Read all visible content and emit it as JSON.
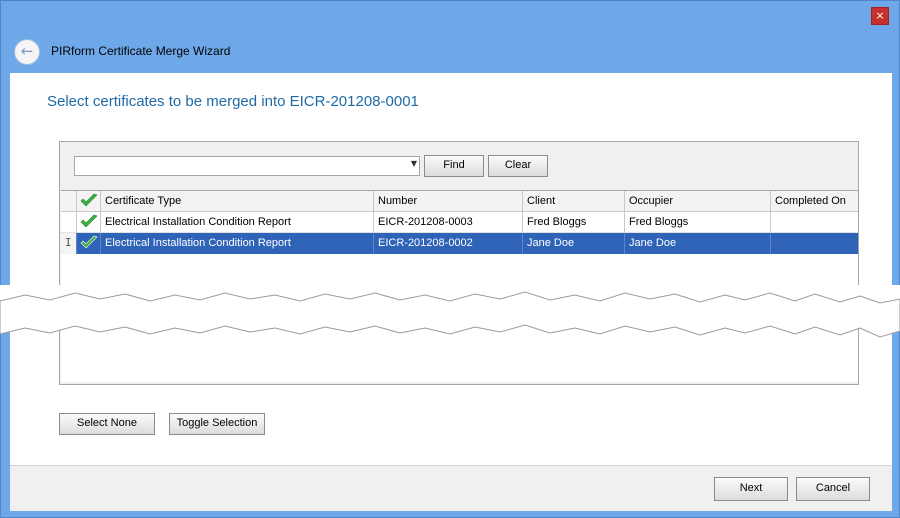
{
  "window": {
    "title": "PIRform Certificate Merge Wizard",
    "close_glyph": "×",
    "back_glyph": "←"
  },
  "heading": "Select certificates to be merged into EICR-201208-0001",
  "search": {
    "value": "",
    "find_label": "Find",
    "clear_label": "Clear"
  },
  "grid": {
    "columns": [
      "",
      "",
      "Certificate Type",
      "Number",
      "Client",
      "Occupier",
      "Completed On"
    ],
    "rows": [
      {
        "checked": true,
        "selected": false,
        "type": "Electrical Installation Condition Report",
        "number": "EICR-201208-0003",
        "client": "Fred Bloggs",
        "occupier": "Fred Bloggs",
        "completed": ""
      },
      {
        "checked": true,
        "selected": true,
        "type": "Electrical Installation Condition Report",
        "number": "EICR-201208-0002",
        "client": "Jane Doe",
        "occupier": "Jane Doe",
        "completed": ""
      }
    ]
  },
  "actions": {
    "select_none": "Select None",
    "toggle_selection": "Toggle Selection"
  },
  "footer": {
    "next": "Next",
    "cancel": "Cancel"
  },
  "colors": {
    "accent": "#1f6aa5",
    "selection": "#2f63b8",
    "chrome": "#6fa8e8",
    "check": "#3cb043"
  }
}
